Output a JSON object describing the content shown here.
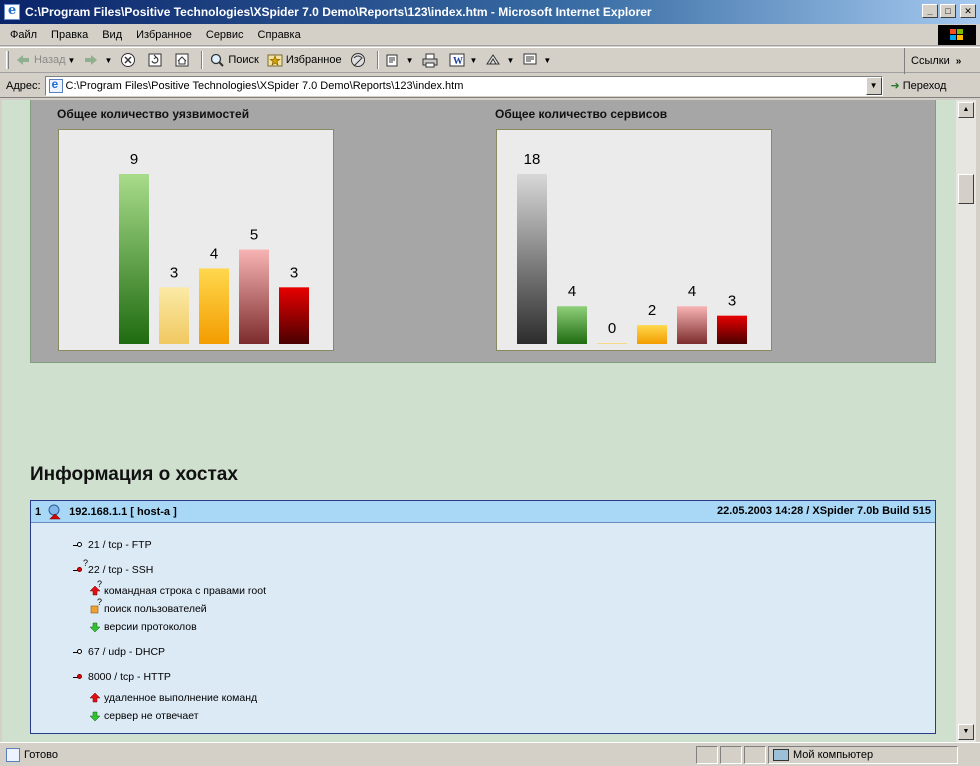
{
  "window": {
    "title": "C:\\Program Files\\Positive Technologies\\XSpider 7.0 Demo\\Reports\\123\\index.htm - Microsoft Internet Explorer",
    "minimize": "_",
    "maximize": "□",
    "close": "✕"
  },
  "menu": {
    "items": [
      "Файл",
      "Правка",
      "Вид",
      "Избранное",
      "Сервис",
      "Справка"
    ]
  },
  "toolbar": {
    "back": "Назад",
    "search": "Поиск",
    "favorites": "Избранное",
    "links": "Ссылки"
  },
  "address": {
    "label": "Адрес:",
    "url": "C:\\Program Files\\Positive Technologies\\XSpider 7.0 Demo\\Reports\\123\\index.htm",
    "go": "Переход"
  },
  "colors": {
    "content_bg": "#cfe0cf",
    "panel_bg": "#a6a6a6",
    "host_header": "#a9d8f7",
    "host_body": "#dceaf6"
  },
  "chart_data": [
    {
      "type": "bar",
      "title": "Общее количество уязвимостей",
      "values": [
        9,
        3,
        4,
        5,
        3
      ],
      "colors": [
        [
          "#a8dc8a",
          "#1f6b10"
        ],
        [
          "#fbeaa6",
          "#f0c860"
        ],
        [
          "#ffd84d",
          "#f39c00"
        ],
        [
          "#f8b4b4",
          "#7c2c2c"
        ],
        [
          "#e80000",
          "#4a0000"
        ]
      ],
      "ylim": [
        0,
        9
      ]
    },
    {
      "type": "bar",
      "title": "Общее количество сервисов",
      "values": [
        18,
        4,
        0,
        2,
        4,
        3
      ],
      "colors": [
        [
          "#d8d8d8",
          "#2c2c2c"
        ],
        [
          "#8fd07a",
          "#1f6b10"
        ],
        [
          "#fbeaa6",
          "#f0c860"
        ],
        [
          "#ffd84d",
          "#f39c00"
        ],
        [
          "#f8b4b4",
          "#7c2c2c"
        ],
        [
          "#e80000",
          "#4a0000"
        ]
      ],
      "ylim": [
        0,
        18
      ]
    }
  ],
  "hosts": {
    "heading": "Информация о хостах",
    "host": {
      "number": "1",
      "name": "192.168.1.1 [ host-a ]",
      "meta": "22.05.2003 14:28 / XSpider 7.0b Build 515",
      "services": [
        {
          "kind": "service",
          "status": "open",
          "text": "21 / tcp - FTP"
        },
        {
          "kind": "service",
          "status": "vuln-unknown",
          "text": "22 / tcp - SSH"
        },
        {
          "kind": "vuln",
          "level": "high-unknown",
          "text": "командная строка с правами root"
        },
        {
          "kind": "vuln",
          "level": "medium-unknown",
          "text": "поиск пользователей"
        },
        {
          "kind": "vuln",
          "level": "info",
          "text": "версии протоколов"
        },
        {
          "kind": "service",
          "status": "open",
          "text": "67 / udp - DHCP"
        },
        {
          "kind": "service",
          "status": "vuln",
          "text": "8000 / tcp - HTTP"
        },
        {
          "kind": "vuln",
          "level": "high",
          "text": "удаленное выполнение команд"
        },
        {
          "kind": "vuln",
          "level": "info",
          "text": "сервер не отвечает"
        }
      ]
    }
  },
  "status": {
    "text": "Готово",
    "zone": "Мой компьютер"
  }
}
